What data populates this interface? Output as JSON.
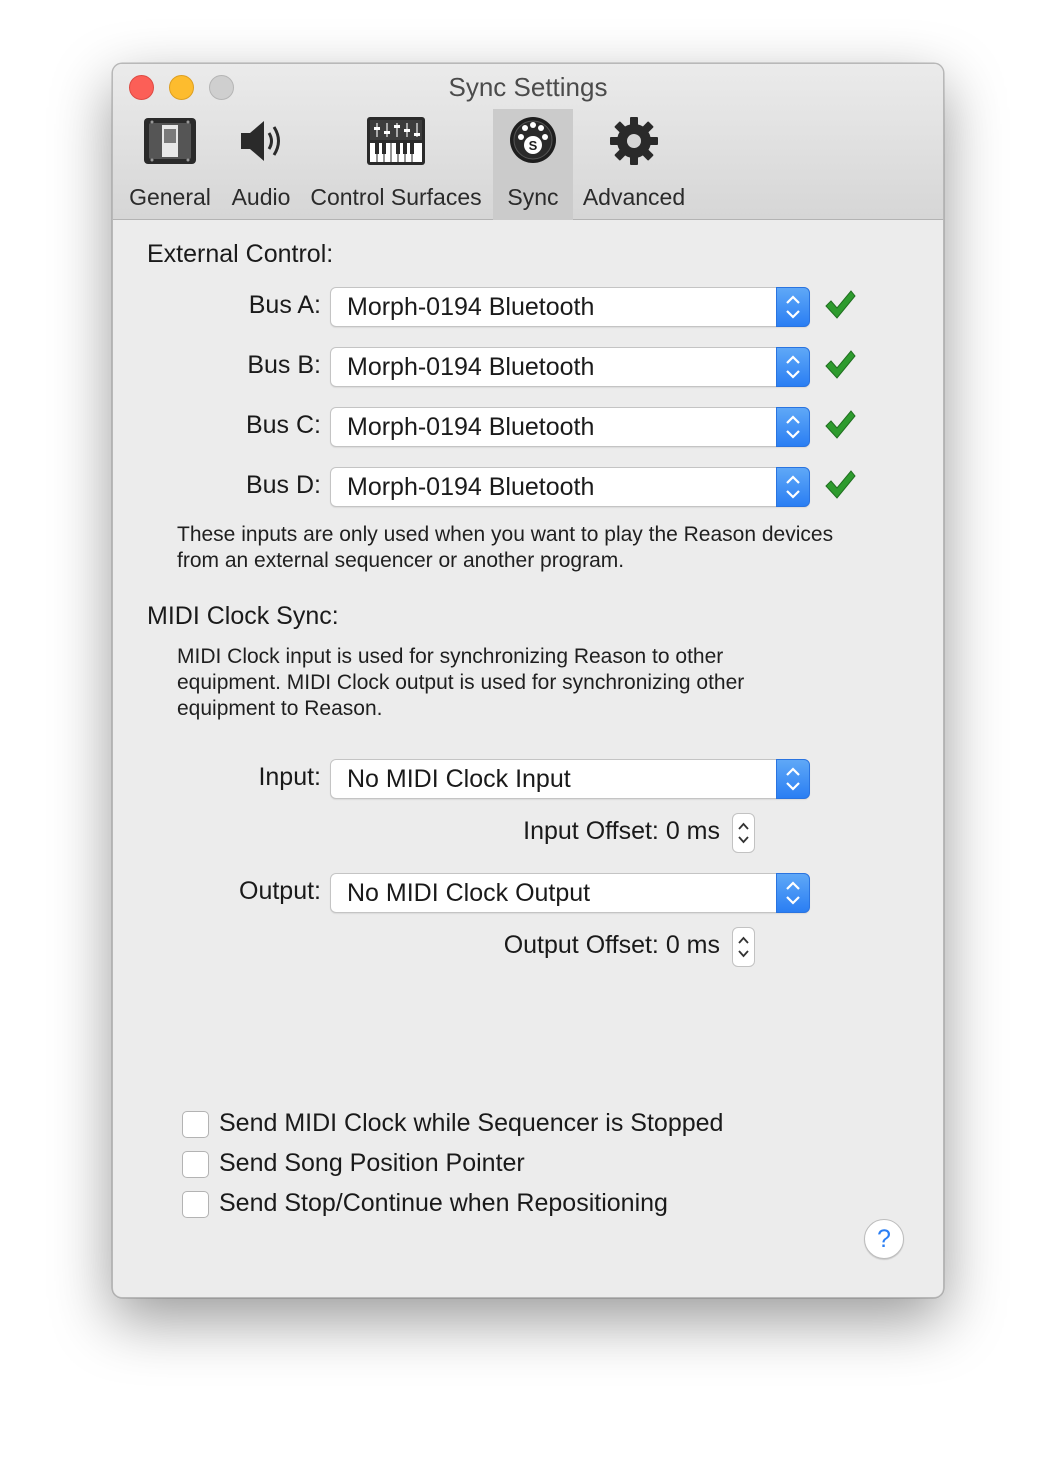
{
  "window": {
    "title": "Sync Settings"
  },
  "toolbar": {
    "tabs": [
      {
        "label": "General",
        "icon": "general-icon"
      },
      {
        "label": "Audio",
        "icon": "speaker-icon"
      },
      {
        "label": "Control Surfaces",
        "icon": "keyboard-mixer-icon"
      },
      {
        "label": "Sync",
        "icon": "midi-sync-icon",
        "active": true
      },
      {
        "label": "Advanced",
        "icon": "gear-icon"
      }
    ]
  },
  "external_control": {
    "title": "External Control:",
    "buses": [
      {
        "label": "Bus A:",
        "value": "Morph-0194 Bluetooth",
        "status": "ok"
      },
      {
        "label": "Bus B:",
        "value": "Morph-0194 Bluetooth",
        "status": "ok"
      },
      {
        "label": "Bus C:",
        "value": "Morph-0194 Bluetooth",
        "status": "ok"
      },
      {
        "label": "Bus D:",
        "value": "Morph-0194 Bluetooth",
        "status": "ok"
      }
    ],
    "note_line1": "These inputs are only used when you want to play the Reason devices",
    "note_line2": "from an external sequencer or another program."
  },
  "midi_clock": {
    "title": "MIDI Clock Sync:",
    "desc_line1": "MIDI Clock input is used for synchronizing Reason to other",
    "desc_line2": "equipment. MIDI Clock output is used for synchronizing other",
    "desc_line3": "equipment to Reason.",
    "input_label": "Input:",
    "input_value": "No MIDI Clock Input",
    "input_offset": "Input Offset: 0 ms",
    "output_label": "Output:",
    "output_value": "No MIDI Clock Output",
    "output_offset": "Output Offset: 0 ms"
  },
  "options": [
    {
      "label": "Send MIDI Clock while Sequencer is Stopped",
      "checked": false
    },
    {
      "label": "Send Song Position Pointer",
      "checked": false
    },
    {
      "label": "Send Stop/Continue when Repositioning",
      "checked": false
    }
  ],
  "help": {
    "label": "?"
  },
  "colors": {
    "accent": "#2a7ef3",
    "check_green": "#2e9b2e",
    "active_tab": "#cbcbcb"
  }
}
